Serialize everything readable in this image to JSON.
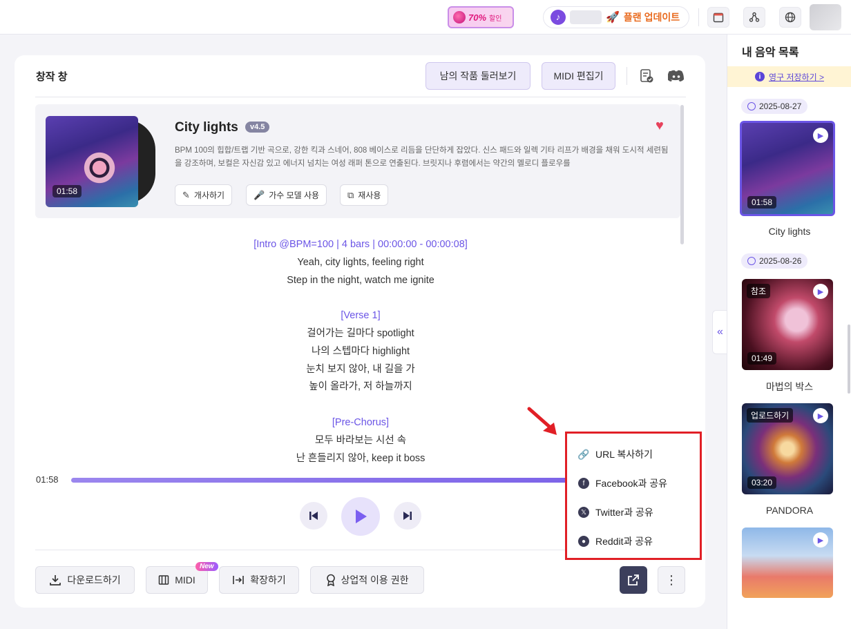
{
  "topbar": {
    "promo_percent": "70%",
    "promo_label": "할인",
    "plan_label": "플랜 업데이트",
    "icons": [
      "calendar-icon",
      "share-network-icon",
      "globe-icon"
    ]
  },
  "card": {
    "title": "창작 창",
    "browse_button": "남의 작품 둘러보기",
    "midi_edit_button": "MIDI 편집기"
  },
  "song": {
    "title": "City lights",
    "version": "v4.5",
    "duration": "01:58",
    "description": "BPM 100의 힙합/트랩 기반 곡으로, 강한 킥과 스네어, 808 베이스로 리듬을 단단하게 잡았다. 신스 패드와 일렉 기타 리프가 배경을 채워 도시적 세련됨을 강조하며, 보컬은 자신감 있고 에너지 넘치는 여성 래퍼 톤으로 연출된다. 브릿지나 후렴에서는 약간의 멜로디 플로우를",
    "actions": [
      "개사하기",
      "가수 모델 사용",
      "재사용"
    ]
  },
  "lyrics": [
    {
      "type": "section",
      "text": "[Intro @BPM=100 | 4 bars | 00:00:00 - 00:00:08]"
    },
    {
      "type": "line",
      "text": "Yeah, city lights, feeling right"
    },
    {
      "type": "line",
      "text": "Step in the night, watch me ignite"
    },
    {
      "type": "blank",
      "text": ""
    },
    {
      "type": "section",
      "text": "[Verse 1]"
    },
    {
      "type": "line",
      "text": "걸어가는 길마다 spotlight"
    },
    {
      "type": "line",
      "text": "나의 스텝마다 highlight"
    },
    {
      "type": "line",
      "text": "눈치 보지 않아, 내 길을 가"
    },
    {
      "type": "line",
      "text": "높이 올라가, 저 하늘까지"
    },
    {
      "type": "blank",
      "text": ""
    },
    {
      "type": "section",
      "text": "[Pre-Chorus]"
    },
    {
      "type": "line",
      "text": "모두 바라보는 시선 속"
    },
    {
      "type": "line",
      "text": "난 흔들리지 않아, keep it boss"
    }
  ],
  "player": {
    "current_time": "01:58",
    "progress": 1.0
  },
  "bottom_actions": {
    "download": "다운로드하기",
    "midi": "MIDI",
    "midi_badge": "New",
    "extend": "확장하기",
    "commercial": "상업적 이용 권한"
  },
  "share_menu": {
    "items": [
      {
        "label": "URL 복사하기",
        "icon": "link-icon"
      },
      {
        "label": "Facebook과 공유",
        "icon": "facebook-icon"
      },
      {
        "label": "Twitter과 공유",
        "icon": "x-twitter-icon"
      },
      {
        "label": "Reddit과 공유",
        "icon": "reddit-icon"
      }
    ]
  },
  "sidebar": {
    "title": "내 음악 목록",
    "save_link": "영구 저장하기 >",
    "groups": [
      {
        "date": "2025-08-27",
        "items": [
          {
            "name": "City lights",
            "duration": "01:58",
            "tag": ""
          }
        ]
      },
      {
        "date": "2025-08-26",
        "items": [
          {
            "name": "마법의 박스",
            "duration": "01:49",
            "tag": "참조"
          },
          {
            "name": "PANDORA",
            "duration": "03:20",
            "tag": "업로드하기"
          },
          {
            "name": "",
            "duration": "",
            "tag": ""
          }
        ]
      }
    ]
  },
  "colors": {
    "accent": "#6b55e6",
    "highlight_red": "#e11f26",
    "heart": "#e6425c"
  }
}
